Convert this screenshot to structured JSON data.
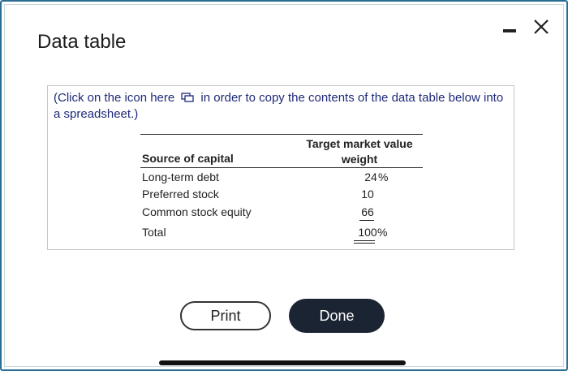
{
  "dialog": {
    "title": "Data table",
    "minimize_icon": "minimize-icon",
    "close_icon": "close-icon"
  },
  "instruction": {
    "before_icon": "(Click on the icon  here",
    "icon": "copy-icon",
    "after_icon": "in order to copy the contents of the data table below into a spreadsheet.)"
  },
  "table": {
    "headers": {
      "source": "Source of capital",
      "weight": "Target market value weight"
    },
    "rows": [
      {
        "label": "Long-term debt",
        "value": "24",
        "suffix": "%"
      },
      {
        "label": "Preferred stock",
        "value": "10",
        "suffix": ""
      },
      {
        "label": "Common stock equity",
        "value": "66",
        "suffix": ""
      }
    ],
    "total": {
      "label": "Total",
      "value": "100",
      "suffix": "%"
    }
  },
  "buttons": {
    "print": "Print",
    "done": "Done"
  },
  "colors": {
    "frame_border": "#2b6e95",
    "instruction_text": "#1f2a7a",
    "done_bg": "#1b2432"
  }
}
